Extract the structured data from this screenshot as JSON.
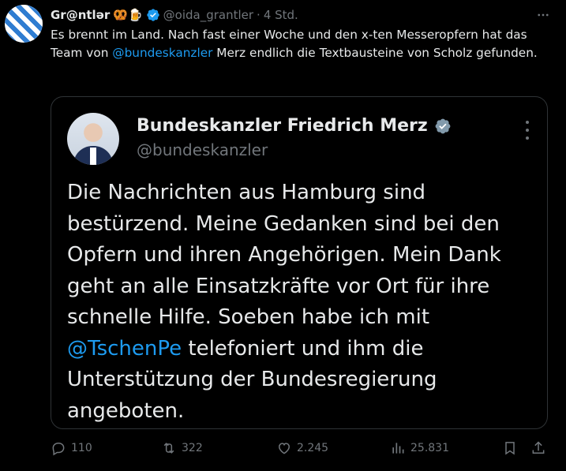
{
  "tweet": {
    "display_name": "Gr@ntlər",
    "emojis": "🥨🍺",
    "handle": "@oida_grantler",
    "separator": "·",
    "time": "4 Std.",
    "text_part1": "Es brennt im Land. Nach fast einer Woche und den x-ten Messeropfern hat das Team von ",
    "text_mention": "@bundeskanzler",
    "text_part2": " Merz endlich die Textbausteine von Scholz gefunden."
  },
  "quote": {
    "display_name": "Bundeskanzler Friedrich Merz",
    "handle": "@bundeskanzler",
    "text_part1": "Die Nachrichten aus Hamburg sind bestürzend. Meine Gedanken sind bei den Opfern und ihren Angehörigen. Mein Dank geht an alle Einsatzkräfte vor Ort für ihre schnelle Hilfe. Soeben habe ich mit ",
    "text_mention": "@TschenPe",
    "text_part2": " telefoniert und ihm die Unterstützung der Bundesregierung angeboten."
  },
  "actions": {
    "replies": "110",
    "reposts": "322",
    "likes": "2.245",
    "views": "25.831"
  },
  "icons": {
    "verified_color": "#1d9bf0",
    "quote_verified_color": "#829aab",
    "mention_color": "#1d9bf0"
  }
}
